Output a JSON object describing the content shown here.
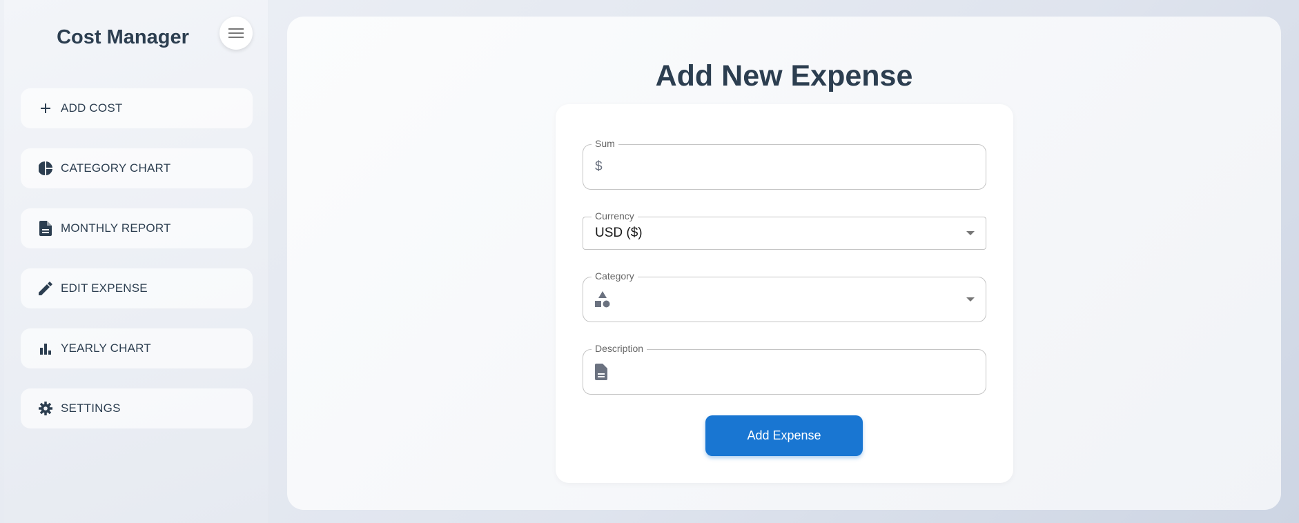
{
  "sidebar": {
    "title": "Cost Manager",
    "items": [
      {
        "label": "ADD COST",
        "icon": "plus-icon"
      },
      {
        "label": "CATEGORY CHART",
        "icon": "pie-chart-icon"
      },
      {
        "label": "MONTHLY REPORT",
        "icon": "document-icon"
      },
      {
        "label": "EDIT EXPENSE",
        "icon": "pencil-icon"
      },
      {
        "label": "YEARLY CHART",
        "icon": "bar-chart-icon"
      },
      {
        "label": "SETTINGS",
        "icon": "gear-icon"
      }
    ]
  },
  "main": {
    "title": "Add New Expense",
    "form": {
      "sum_label": "Sum",
      "sum_prefix": "$",
      "sum_value": "",
      "currency_label": "Currency",
      "currency_value": "USD ($)",
      "category_label": "Category",
      "category_value": "",
      "description_label": "Description",
      "description_value": "",
      "submit_label": "Add Expense"
    }
  },
  "colors": {
    "accent": "#1976d2",
    "text": "#2c3e50"
  }
}
